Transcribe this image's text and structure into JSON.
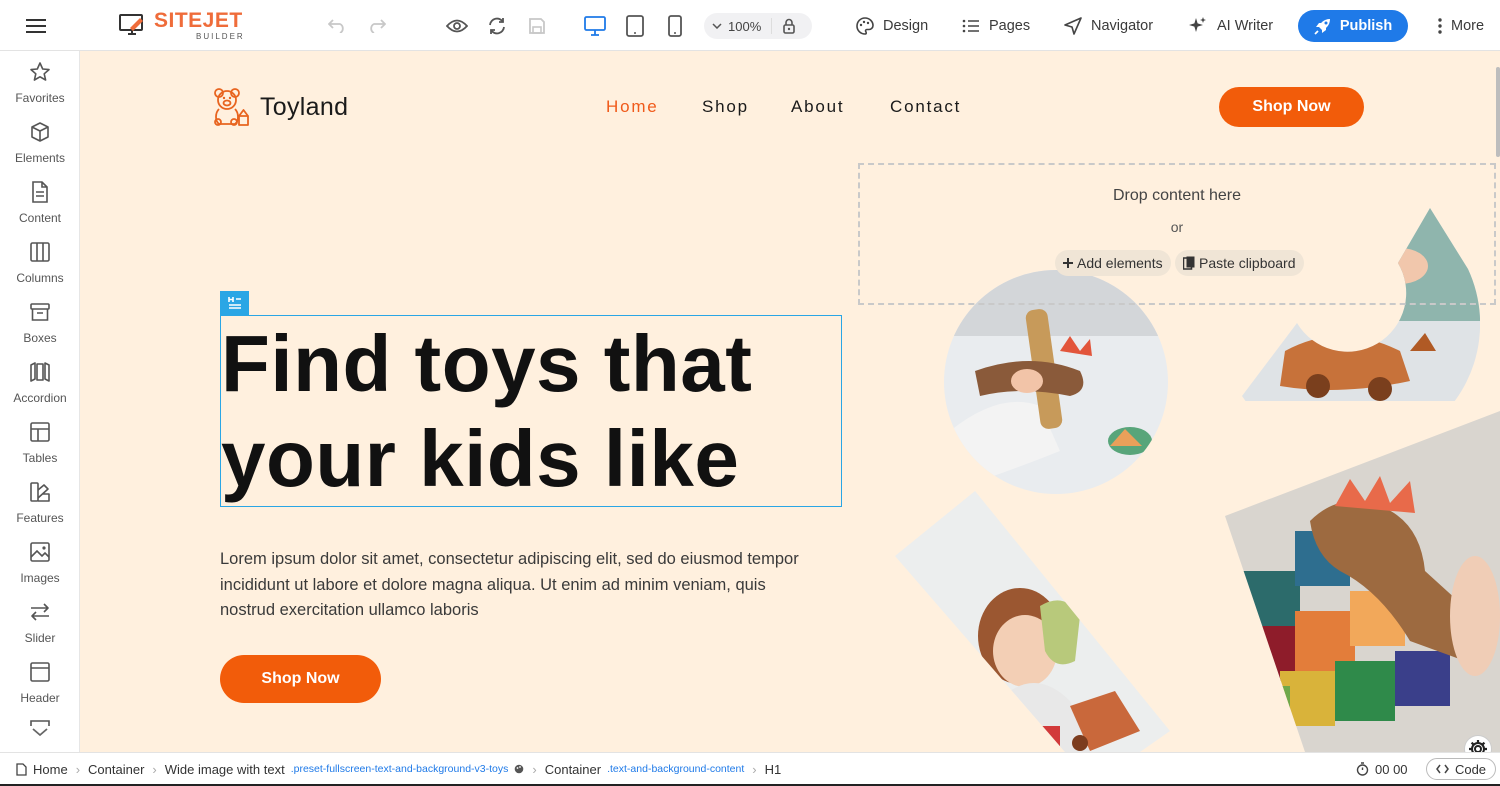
{
  "toolbar": {
    "logo_brand": "SITEJET",
    "logo_sub": "BUILDER",
    "zoom": "100%",
    "design": "Design",
    "pages": "Pages",
    "navigator": "Navigator",
    "ai_writer": "AI Writer",
    "publish": "Publish",
    "more": "More"
  },
  "sidebar": {
    "items": [
      {
        "label": "Favorites",
        "icon": "star-icon"
      },
      {
        "label": "Elements",
        "icon": "cube-icon"
      },
      {
        "label": "Content",
        "icon": "document-icon"
      },
      {
        "label": "Columns",
        "icon": "columns-icon"
      },
      {
        "label": "Boxes",
        "icon": "box-icon"
      },
      {
        "label": "Accordion",
        "icon": "accordion-icon"
      },
      {
        "label": "Tables",
        "icon": "table-icon"
      },
      {
        "label": "Features",
        "icon": "features-icon"
      },
      {
        "label": "Images",
        "icon": "image-icon"
      },
      {
        "label": "Slider",
        "icon": "slider-icon"
      },
      {
        "label": "Header",
        "icon": "header-icon"
      }
    ]
  },
  "site": {
    "name": "Toyland",
    "nav": [
      "Home",
      "Shop",
      "About",
      "Contact"
    ],
    "cta_header": "Shop Now",
    "hero_line1": "Find toys that",
    "hero_line2": "your kids like",
    "hero_text": "Lorem ipsum dolor sit amet, consectetur adipiscing elit, sed do eiusmod tempor incididunt ut labore et dolore magna aliqua. Ut enim ad minim veniam, quis nostrud exercitation ullamco laboris",
    "cta_hero": "Shop Now"
  },
  "dropzone": {
    "main": "Drop content here",
    "or": "or",
    "add": "Add elements",
    "paste": "Paste clipboard"
  },
  "breadcrumb": {
    "home": "Home",
    "c1": "Container",
    "c2": "Wide image with text",
    "c2_class": ".preset-fullscreen-text-and-background-v3-toys",
    "c3": "Container",
    "c3_class": ".text-and-background-content",
    "c4": "H1"
  },
  "status": {
    "timer": "00 00",
    "code": "Code"
  },
  "colors": {
    "accent": "#f25c0a",
    "canvas_bg": "#fff0de",
    "publish_blue": "#1f7ae8",
    "selection_blue": "#2aa6e5"
  }
}
